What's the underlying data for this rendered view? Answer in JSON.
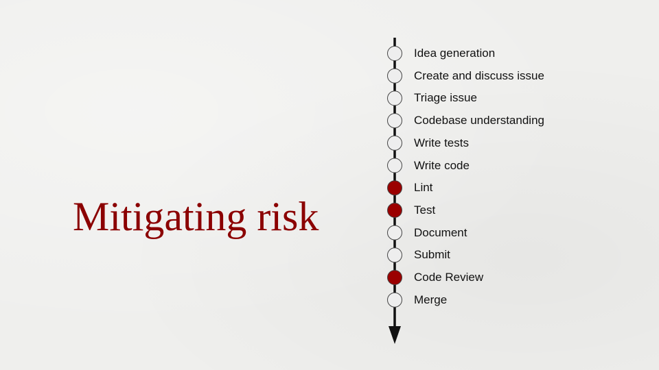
{
  "title": "Mitigating risk",
  "colors": {
    "title": "#8b0000",
    "highlight_fill": "#9b0000",
    "node_fill": "#eeeeee",
    "axis": "#111111"
  },
  "steps": [
    {
      "label": "Idea generation",
      "highlighted": false
    },
    {
      "label": "Create and discuss issue",
      "highlighted": false
    },
    {
      "label": "Triage issue",
      "highlighted": false
    },
    {
      "label": "Codebase understanding",
      "highlighted": false
    },
    {
      "label": "Write tests",
      "highlighted": false
    },
    {
      "label": "Write code",
      "highlighted": false
    },
    {
      "label": "Lint",
      "highlighted": true
    },
    {
      "label": "Test",
      "highlighted": true
    },
    {
      "label": "Document",
      "highlighted": false
    },
    {
      "label": "Submit",
      "highlighted": false
    },
    {
      "label": "Code Review",
      "highlighted": true
    },
    {
      "label": "Merge",
      "highlighted": false
    }
  ]
}
